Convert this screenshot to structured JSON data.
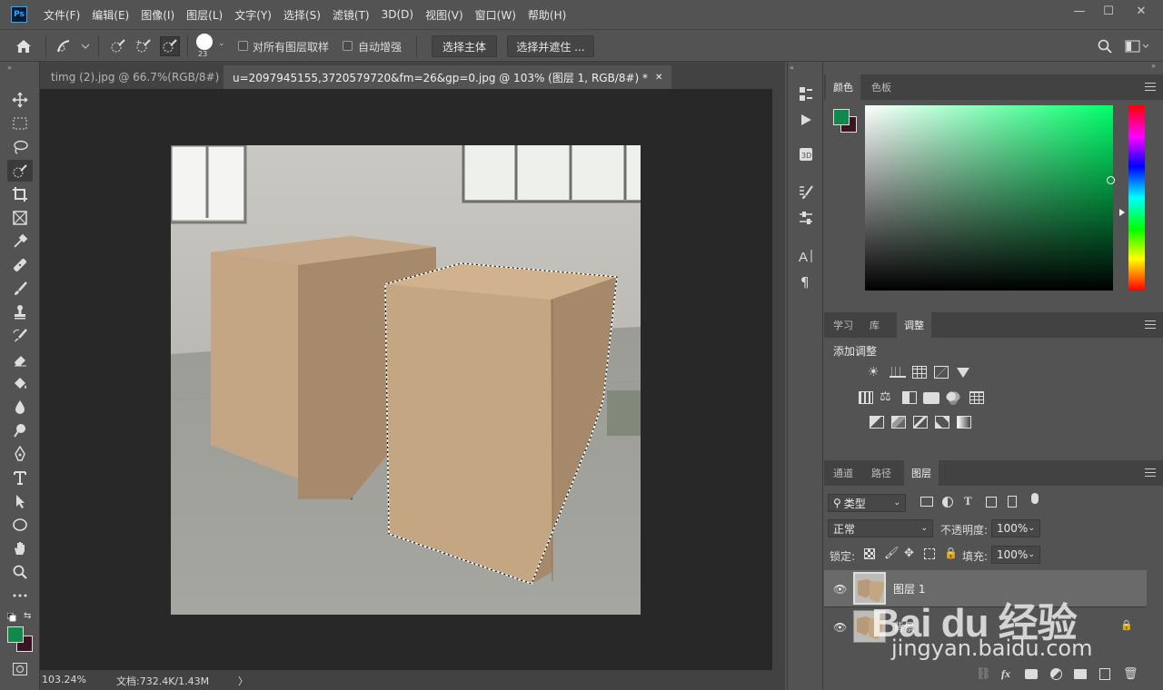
{
  "app": {
    "logo": "Ps",
    "menu": [
      "文件(F)",
      "编辑(E)",
      "图像(I)",
      "图层(L)",
      "文字(Y)",
      "选择(S)",
      "滤镜(T)",
      "3D(D)",
      "视图(V)",
      "窗口(W)",
      "帮助(H)"
    ],
    "window_controls": {
      "minimize": "—",
      "restore": "☐",
      "close": "✕"
    }
  },
  "options_bar": {
    "brush_size": "23",
    "sample_all_layers_label": "对所有图层取样",
    "auto_enhance_label": "自动增强",
    "select_subject_label": "选择主体",
    "select_and_mask_label": "选择并遮住 ..."
  },
  "tabs": [
    {
      "title": "timg (2).jpg @ 66.7%(RGB/8#)",
      "active": false
    },
    {
      "title": "u=2097945155,3720579720&fm=26&gp=0.jpg @ 103% (图层 1, RGB/8#) *",
      "active": true
    }
  ],
  "status": {
    "zoom": "103.24%",
    "doc_info": "文档:732.4K/1.43M",
    "arrow": "〉"
  },
  "colors": {
    "foreground": "#0f8a4c",
    "background": "#3a1420",
    "picker_hue": "#00ff6a",
    "panel_bg": "#535353",
    "canvas_bg": "#282828"
  },
  "color_panel": {
    "tabs": [
      "颜色",
      "色板"
    ]
  },
  "adjust_panel": {
    "tabs": [
      "学习",
      "库",
      "调整"
    ],
    "title": "添加调整"
  },
  "layers_panel": {
    "tabs": [
      "通道",
      "路径",
      "图层"
    ],
    "filter_label": "类型",
    "blend_mode": "正常",
    "opacity_label": "不透明度:",
    "opacity_value": "100%",
    "lock_label": "锁定:",
    "fill_label": "填充:",
    "fill_value": "100%",
    "layers": [
      {
        "name": "图层 1",
        "selected": true,
        "locked": false
      },
      {
        "name": "背景",
        "selected": false,
        "locked": true
      }
    ],
    "bottom_icons": [
      "link-icon",
      "fx-icon",
      "mask-icon",
      "adjustment-icon",
      "folder-icon",
      "new-layer-icon",
      "trash-icon"
    ],
    "fx_label": "fx"
  },
  "watermark": {
    "brand": "Bai du 经验",
    "url": "jingyan.baidu.com"
  }
}
